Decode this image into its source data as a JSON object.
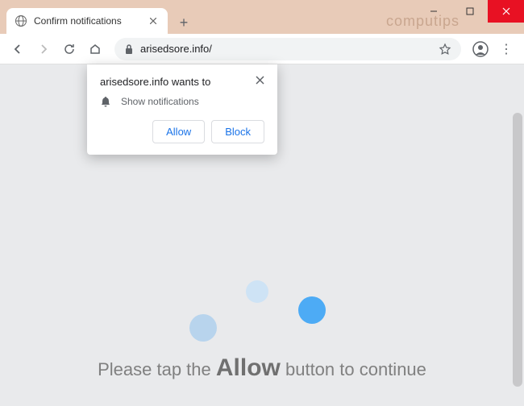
{
  "window": {
    "watermark": "computips"
  },
  "tab": {
    "title": "Confirm notifications"
  },
  "url": {
    "address": "arisedsore.info/"
  },
  "popup": {
    "title": "arisedsore.info wants to",
    "permission_text": "Show notifications",
    "allow_label": "Allow",
    "block_label": "Block"
  },
  "page": {
    "instruction_prefix": "Please tap the ",
    "instruction_emphasis": "Allow",
    "instruction_suffix": " button to continue"
  }
}
